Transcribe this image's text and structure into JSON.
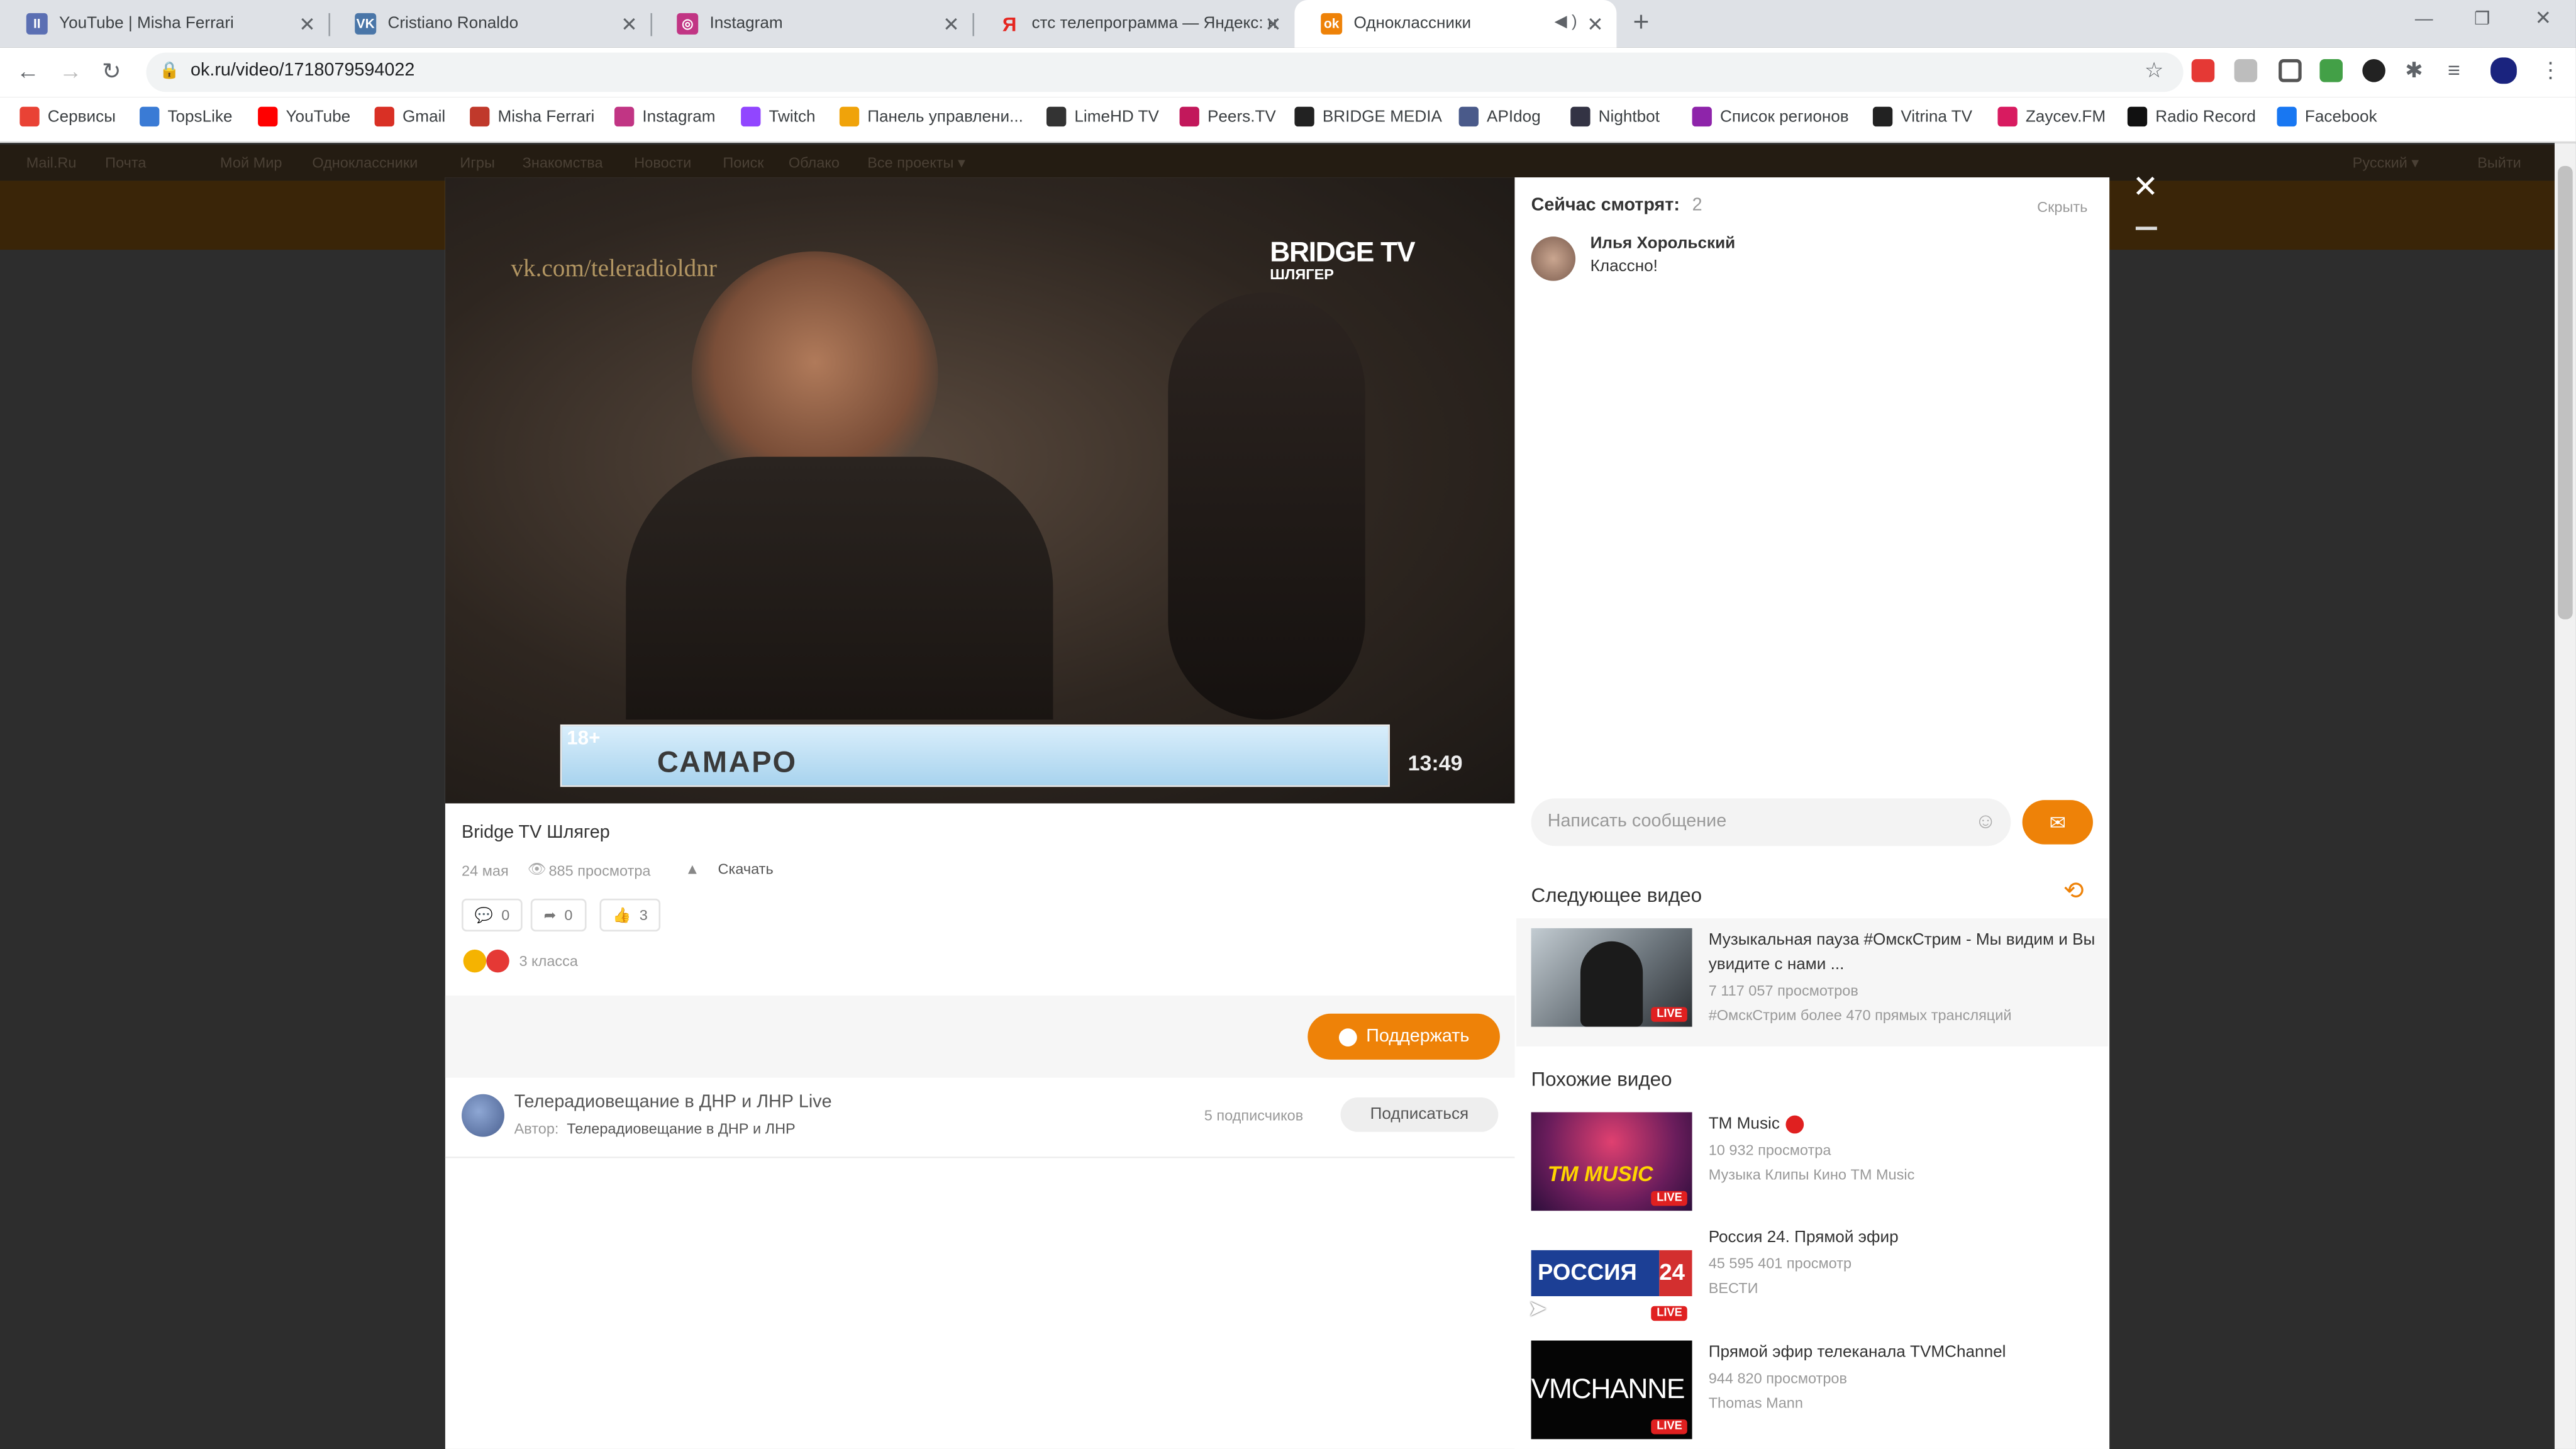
{
  "browser": {
    "tabs": [
      {
        "title": "YouTube | Misha Ferrari",
        "icon": "tv-icon",
        "color": "#5b6fb3"
      },
      {
        "title": "Cristiano Ronaldo",
        "icon": "vk-icon",
        "color": "#4a76a8"
      },
      {
        "title": "Instagram",
        "icon": "instagram-icon",
        "color": "#c13584"
      },
      {
        "title": "стс телепрограмма — Яндекс: н",
        "icon": "yandex-icon",
        "color": "#e52620"
      },
      {
        "title": "Одноклассники",
        "icon": "ok-icon",
        "color": "#ee8208"
      }
    ],
    "new_tab_glyph": "+",
    "url": "ok.ru/video/1718079594022",
    "bookmarks": [
      {
        "label": "Сервисы",
        "icon": "apps-icon",
        "color": "#e94235"
      },
      {
        "label": "TopsLike",
        "icon": "topslike-icon",
        "color": "#3a7bd5"
      },
      {
        "label": "YouTube",
        "icon": "youtube-icon",
        "color": "#ff0000"
      },
      {
        "label": "Gmail",
        "icon": "gmail-icon",
        "color": "#d93025"
      },
      {
        "label": "Misha Ferrari",
        "icon": "misha-icon",
        "color": "#c0392b"
      },
      {
        "label": "Instagram",
        "icon": "instagram-icon",
        "color": "#c13584"
      },
      {
        "label": "Twitch",
        "icon": "twitch-icon",
        "color": "#9146ff"
      },
      {
        "label": "Панель управлени...",
        "icon": "panel-icon",
        "color": "#f0a30a"
      },
      {
        "label": "LimeHD TV",
        "icon": "limehd-icon",
        "color": "#333333"
      },
      {
        "label": "Peers.TV",
        "icon": "peerstv-icon",
        "color": "#c2185b"
      },
      {
        "label": "BRIDGE MEDIA",
        "icon": "bridge-icon",
        "color": "#222222"
      },
      {
        "label": "APIdog",
        "icon": "apidog-icon",
        "color": "#4a5a8a"
      },
      {
        "label": "Nightbot",
        "icon": "nightbot-icon",
        "color": "#333344"
      },
      {
        "label": "Список регионов",
        "icon": "regions-icon",
        "color": "#8e24aa"
      },
      {
        "label": "Vitrina TV",
        "icon": "vitrina-icon",
        "color": "#222222"
      },
      {
        "label": "Zaycev.FM",
        "icon": "zaycev-icon",
        "color": "#d81b60"
      },
      {
        "label": "Radio Record",
        "icon": "radiorecord-icon",
        "color": "#111111"
      },
      {
        "label": "Facebook",
        "icon": "facebook-icon",
        "color": "#1877f2"
      }
    ]
  },
  "okbar": {
    "links": [
      "Mail.Ru",
      "Почта",
      "Мой Мир",
      "Одноклассники",
      "Игры",
      "Знакомства",
      "Новости",
      "Поиск",
      "Облако",
      "Все проекты ▾"
    ],
    "lang": "Русский ▾",
    "logout": "Выйти"
  },
  "video": {
    "watermark_url": "vk.com/teleradioldnr",
    "channel_logo": "BRIDGE TV",
    "channel_logo_sub": "ШЛЯГЕР",
    "age": "18+",
    "ticker": "САМАРО",
    "clock": "13:49",
    "title": "Bridge TV Шлягер",
    "date": "24 мая",
    "views": "885 просмотра",
    "download": "Скачать",
    "comments": "0",
    "shares": "0",
    "likes": "3",
    "klass": "3 класса",
    "support_button": "Поддержать",
    "channel_name": "Телерадиовещание в ДНР и ЛНР Live",
    "author_label": "Автор:",
    "author": "Телерадиовещание в ДНР и ЛНР",
    "subscribers": "5 подписчиков",
    "subscribe_button": "Подписаться"
  },
  "chat": {
    "watching_label": "Сейчас смотрят:",
    "watching_count": "2",
    "hide": "Скрыть",
    "messages": [
      {
        "user": "Илья Хорольский",
        "text": "Классно!"
      }
    ],
    "input_placeholder": "Написать сообщение",
    "next_title": "Следующее видео",
    "next": {
      "title_line1": "Музыкальная пауза #ОмскСтрим - Мы видим и Вы",
      "title_line2": "увидите с нами ...",
      "views": "7 117 057 просмотров",
      "channel": "#ОмскСтрим более 470 прямых трансляций",
      "badge": "LIVE"
    },
    "similar_title": "Похожие видео",
    "similar": [
      {
        "title": "TM Music",
        "views": "10 932 просмотра",
        "channel": "Музыка Клипы Кино TM Music",
        "badge": "LIVE",
        "thumb_text": "TM MUSIC"
      },
      {
        "title": "Россия 24. Прямой эфир",
        "views": "45 595 401 просмотр",
        "channel": "ВЕСТИ",
        "badge": "LIVE",
        "thumb_text": "РОССИЯ",
        "thumb_num": "24"
      },
      {
        "title": "Прямой эфир телеканала TVMChannel",
        "views": "944 820 просмотров",
        "channel": "Thomas Mann",
        "badge": "LIVE",
        "thumb_text": "VMCHANNE"
      }
    ]
  },
  "colors": {
    "accent": "#ee8208",
    "live": "#e02020"
  }
}
